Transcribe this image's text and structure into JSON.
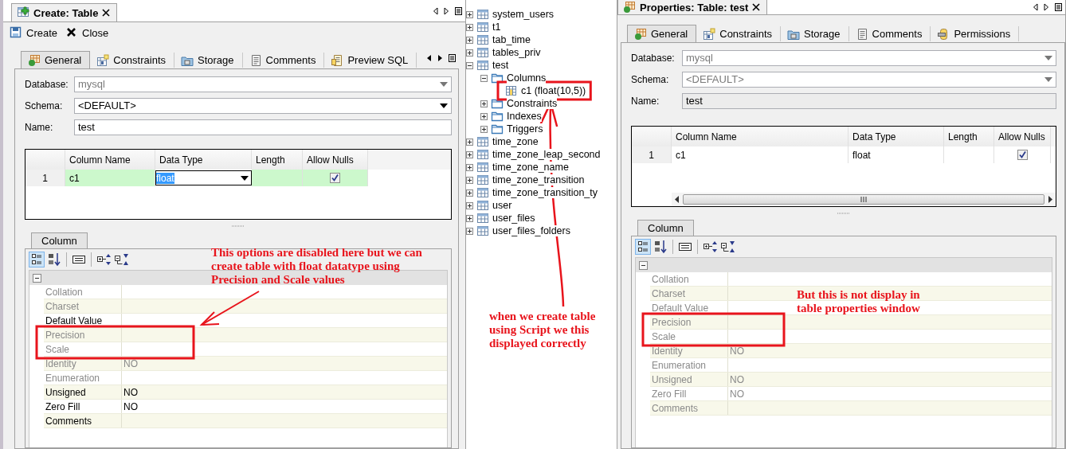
{
  "create_panel": {
    "doc_tab": {
      "title": "Create: Table",
      "kind": "create"
    },
    "toolbar": [
      {
        "label": "Create",
        "kind": "save"
      },
      {
        "label": "Close",
        "kind": "close"
      }
    ],
    "tabs": [
      {
        "label": "General",
        "kind": "general",
        "selected": true
      },
      {
        "label": "Constraints",
        "kind": "constraints",
        "selected": false
      },
      {
        "label": "Storage",
        "kind": "storage",
        "selected": false
      },
      {
        "label": "Comments",
        "kind": "comments",
        "selected": false
      },
      {
        "label": "Preview SQL",
        "kind": "preview",
        "selected": false
      }
    ],
    "fields": [
      {
        "label": "Database:",
        "value": "mysql",
        "kind": "dropdown",
        "disabled": true
      },
      {
        "label": "Schema:",
        "value": "<DEFAULT>",
        "kind": "dropdown",
        "disabled": false
      },
      {
        "label": "Name:",
        "value": "test",
        "kind": "text",
        "disabled": false
      }
    ],
    "grid": {
      "columns": [
        "Column Name",
        "Data Type",
        "Length",
        "Allow Nulls"
      ],
      "rows": [
        {
          "number": "1",
          "name": "c1",
          "data_type": "float",
          "allow_nulls": true,
          "editing": true
        }
      ]
    },
    "detail_tab": "Column",
    "properties": [
      {
        "name": "Collation",
        "disabled": true
      },
      {
        "name": "Charset",
        "disabled": true
      },
      {
        "name": "Default Value",
        "disabled": false
      },
      {
        "name": "Precision",
        "disabled": true
      },
      {
        "name": "Scale",
        "disabled": true
      },
      {
        "name": "Identity",
        "value": "NO",
        "disabled": true
      },
      {
        "name": "Enumeration",
        "disabled": true
      },
      {
        "name": "Unsigned",
        "value": "NO",
        "disabled": false
      },
      {
        "name": "Zero Fill",
        "value": "NO",
        "disabled": false
      },
      {
        "name": "Comments",
        "disabled": false
      }
    ]
  },
  "tree": {
    "items": [
      {
        "label": "system_users",
        "kind": "table",
        "expanded": false
      },
      {
        "label": "t1",
        "kind": "table",
        "expanded": false
      },
      {
        "label": "tab_time",
        "kind": "table",
        "expanded": false
      },
      {
        "label": "tables_priv",
        "kind": "table",
        "expanded": false
      },
      {
        "label": "test",
        "kind": "table",
        "expanded": true,
        "children": [
          {
            "label": "Columns",
            "kind": "folder",
            "expanded": true,
            "children": [
              {
                "label": "c1 (float(10,5))",
                "kind": "column"
              }
            ]
          },
          {
            "label": "Constraints",
            "kind": "folder",
            "expanded": false
          },
          {
            "label": "Indexes",
            "kind": "folder",
            "expanded": false
          },
          {
            "label": "Triggers",
            "kind": "folder",
            "expanded": false
          }
        ]
      },
      {
        "label": "time_zone",
        "kind": "table",
        "expanded": false
      },
      {
        "label": "time_zone_leap_second",
        "kind": "table",
        "expanded": false
      },
      {
        "label": "time_zone_name",
        "kind": "table",
        "expanded": false
      },
      {
        "label": "time_zone_transition",
        "kind": "table",
        "expanded": false
      },
      {
        "label": "time_zone_transition_ty",
        "kind": "table",
        "expanded": false
      },
      {
        "label": "user",
        "kind": "table",
        "expanded": false
      },
      {
        "label": "user_files",
        "kind": "table",
        "expanded": false
      },
      {
        "label": "user_files_folders",
        "kind": "table",
        "expanded": false
      }
    ]
  },
  "properties_panel": {
    "doc_tab": {
      "title": "Properties: Table: test",
      "kind": "properties"
    },
    "tabs": [
      {
        "label": "General",
        "kind": "general",
        "selected": true
      },
      {
        "label": "Constraints",
        "kind": "constraints",
        "selected": false
      },
      {
        "label": "Storage",
        "kind": "storage",
        "selected": false
      },
      {
        "label": "Comments",
        "kind": "comments",
        "selected": false
      },
      {
        "label": "Permissions",
        "kind": "permissions",
        "selected": false
      }
    ],
    "fields": [
      {
        "label": "Database:",
        "value": "mysql",
        "kind": "dropdown",
        "disabled": true
      },
      {
        "label": "Schema:",
        "value": "<DEFAULT>",
        "kind": "dropdown",
        "disabled": true
      },
      {
        "label": "Name:",
        "value": "test",
        "kind": "text",
        "disabled": true
      }
    ],
    "grid": {
      "columns": [
        "Column Name",
        "Data Type",
        "Length",
        "Allow Nulls"
      ],
      "rows": [
        {
          "number": "1",
          "name": "c1",
          "data_type": "float",
          "allow_nulls": true,
          "editing": false
        }
      ]
    },
    "detail_tab": "Column",
    "properties": [
      {
        "name": "Collation",
        "disabled": true
      },
      {
        "name": "Charset",
        "disabled": true
      },
      {
        "name": "Default Value",
        "disabled": true
      },
      {
        "name": "Precision",
        "disabled": true
      },
      {
        "name": "Scale",
        "disabled": true
      },
      {
        "name": "Identity",
        "value": "NO",
        "disabled": true
      },
      {
        "name": "Enumeration",
        "disabled": true
      },
      {
        "name": "Unsigned",
        "value": "NO",
        "disabled": true
      },
      {
        "name": "Zero Fill",
        "value": "NO",
        "disabled": true
      },
      {
        "name": "Comments",
        "disabled": true
      }
    ]
  },
  "annotations": [
    {
      "text": "This options are disabled here but we can create table with float datatype using Precision and Scale values"
    },
    {
      "text": "when we create table using Script we this displayed correctly"
    },
    {
      "text": "But this is not display in table properties window"
    }
  ]
}
